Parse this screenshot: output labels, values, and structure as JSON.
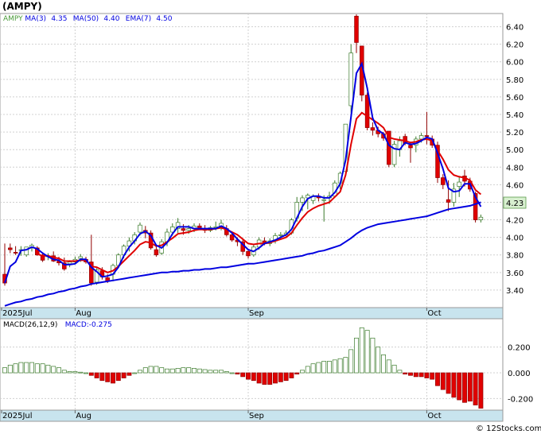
{
  "title": "(AMPY)",
  "watermark": "© 12Stocks.com",
  "colors": {
    "up": "#4a9a3a",
    "down": "#e00000",
    "ma": "#0000e0",
    "ema": "#e00000",
    "axisband": "#c8e4ee",
    "price_box": "#d8f0d0"
  },
  "chart_data": [
    {
      "type": "candlestick",
      "legend": [
        {
          "text": "AMPY",
          "color": "#4a9a3a"
        },
        {
          "text": "MA(3)",
          "color": "#0000e0"
        },
        {
          "text": "4.35",
          "color": "#0000e0"
        },
        {
          "text": "MA(50)",
          "color": "#0000e0"
        },
        {
          "text": "4.40",
          "color": "#0000e0"
        },
        {
          "text": "EMA(7)",
          "color": "#0000e0"
        },
        {
          "text": "4.50",
          "color": "#0000e0"
        }
      ],
      "last_price": "4.23",
      "y_ticks": [
        "3.40",
        "3.60",
        "3.80",
        "4.00",
        "4.20",
        "4.40",
        "4.60",
        "4.80",
        "5.00",
        "5.20",
        "5.40",
        "5.60",
        "5.80",
        "6.00",
        "6.20",
        "6.40"
      ],
      "ylim": [
        3.2,
        6.55
      ],
      "x_labels": [
        {
          "text": "2025Jul",
          "idx": 0
        },
        {
          "text": "Aug",
          "idx": 13
        },
        {
          "text": "Sep",
          "idx": 45
        },
        {
          "text": "Oct",
          "idx": 78
        }
      ],
      "candles": [
        [
          3.58,
          3.93,
          3.45,
          3.48
        ],
        [
          3.88,
          3.93,
          3.82,
          3.86
        ],
        [
          3.83,
          3.9,
          3.8,
          3.82
        ],
        [
          3.85,
          3.9,
          3.79,
          3.86
        ],
        [
          3.8,
          3.89,
          3.78,
          3.89
        ],
        [
          3.88,
          3.93,
          3.84,
          3.91
        ],
        [
          3.88,
          3.9,
          3.79,
          3.8
        ],
        [
          3.8,
          3.83,
          3.72,
          3.74
        ],
        [
          3.78,
          3.82,
          3.74,
          3.79
        ],
        [
          3.79,
          3.84,
          3.72,
          3.73
        ],
        [
          3.73,
          3.78,
          3.68,
          3.71
        ],
        [
          3.71,
          3.77,
          3.62,
          3.64
        ],
        [
          3.7,
          3.74,
          3.66,
          3.72
        ],
        [
          3.72,
          3.78,
          3.7,
          3.75
        ],
        [
          3.76,
          3.81,
          3.72,
          3.78
        ],
        [
          3.75,
          3.78,
          3.7,
          3.72
        ],
        [
          3.72,
          4.03,
          3.45,
          3.48
        ],
        [
          3.49,
          3.65,
          3.46,
          3.63
        ],
        [
          3.62,
          3.66,
          3.52,
          3.55
        ],
        [
          3.54,
          3.58,
          3.48,
          3.5
        ],
        [
          3.58,
          3.7,
          3.5,
          3.68
        ],
        [
          3.68,
          3.82,
          3.66,
          3.8
        ],
        [
          3.8,
          3.92,
          3.76,
          3.9
        ],
        [
          3.9,
          4.0,
          3.84,
          3.96
        ],
        [
          3.96,
          4.06,
          3.92,
          4.03
        ],
        [
          4.06,
          4.17,
          4.02,
          4.14
        ],
        [
          4.08,
          4.13,
          3.99,
          4.05
        ],
        [
          4.05,
          4.08,
          3.86,
          3.88
        ],
        [
          3.86,
          3.92,
          3.78,
          3.8
        ],
        [
          3.82,
          3.98,
          3.8,
          3.95
        ],
        [
          3.95,
          4.1,
          3.9,
          4.06
        ],
        [
          4.06,
          4.16,
          4.02,
          4.12
        ],
        [
          4.1,
          4.22,
          4.05,
          4.17
        ],
        [
          4.1,
          4.15,
          4.03,
          4.08
        ],
        [
          4.08,
          4.14,
          4.04,
          4.1
        ],
        [
          4.1,
          4.16,
          4.06,
          4.13
        ],
        [
          4.13,
          4.16,
          4.09,
          4.1
        ],
        [
          4.1,
          4.14,
          4.05,
          4.08
        ],
        [
          4.08,
          4.13,
          4.06,
          4.11
        ],
        [
          4.11,
          4.18,
          4.08,
          4.12
        ],
        [
          4.12,
          4.2,
          4.08,
          4.16
        ],
        [
          4.1,
          4.14,
          4.01,
          4.03
        ],
        [
          4.03,
          4.06,
          3.95,
          3.97
        ],
        [
          3.97,
          4.0,
          3.9,
          3.95
        ],
        [
          3.95,
          3.99,
          3.8,
          3.84
        ],
        [
          3.84,
          3.86,
          3.76,
          3.79
        ],
        [
          3.8,
          3.92,
          3.78,
          3.89
        ],
        [
          3.89,
          4.0,
          3.86,
          3.97
        ],
        [
          3.96,
          4.0,
          3.91,
          3.93
        ],
        [
          3.93,
          3.99,
          3.9,
          3.96
        ],
        [
          3.96,
          4.05,
          3.93,
          4.02
        ],
        [
          4.02,
          4.06,
          3.98,
          4.03
        ],
        [
          4.03,
          4.08,
          4.01,
          4.05
        ],
        [
          4.05,
          4.22,
          4.03,
          4.2
        ],
        [
          4.22,
          4.46,
          4.18,
          4.4
        ],
        [
          4.4,
          4.48,
          4.3,
          4.45
        ],
        [
          4.45,
          4.5,
          4.32,
          4.48
        ],
        [
          4.42,
          4.49,
          4.38,
          4.47
        ],
        [
          4.47,
          4.5,
          4.41,
          4.45
        ],
        [
          4.42,
          4.48,
          4.18,
          4.43
        ],
        [
          4.45,
          4.52,
          4.38,
          4.47
        ],
        [
          4.47,
          4.65,
          4.45,
          4.62
        ],
        [
          4.62,
          4.75,
          4.55,
          4.73
        ],
        [
          4.75,
          5.29,
          4.7,
          5.29
        ],
        [
          5.5,
          6.2,
          5.42,
          6.1
        ],
        [
          6.52,
          6.54,
          6.1,
          6.22
        ],
        [
          6.18,
          6.18,
          5.55,
          5.62
        ],
        [
          5.62,
          5.65,
          5.22,
          5.25
        ],
        [
          5.25,
          5.31,
          5.16,
          5.22
        ],
        [
          5.22,
          5.26,
          5.14,
          5.18
        ],
        [
          5.18,
          5.2,
          5.1,
          5.13
        ],
        [
          5.21,
          5.21,
          4.8,
          4.83
        ],
        [
          4.83,
          5.1,
          4.8,
          5.06
        ],
        [
          5.0,
          5.15,
          4.92,
          5.1
        ],
        [
          5.15,
          5.18,
          5.05,
          5.07
        ],
        [
          5.05,
          5.09,
          4.85,
          5.02
        ],
        [
          5.05,
          5.15,
          4.97,
          5.12
        ],
        [
          5.12,
          5.19,
          5.08,
          5.16
        ],
        [
          5.16,
          5.43,
          5.06,
          5.15
        ],
        [
          5.12,
          5.16,
          5.02,
          5.05
        ],
        [
          5.05,
          5.09,
          4.62,
          4.68
        ],
        [
          4.68,
          4.72,
          4.55,
          4.6
        ],
        [
          4.43,
          4.65,
          4.3,
          4.4
        ],
        [
          4.4,
          4.62,
          4.35,
          4.55
        ],
        [
          4.58,
          4.7,
          4.46,
          4.63
        ],
        [
          4.7,
          4.77,
          4.58,
          4.64
        ],
        [
          4.64,
          4.68,
          4.52,
          4.55
        ],
        [
          4.5,
          4.52,
          4.17,
          4.2
        ],
        [
          4.2,
          4.26,
          4.17,
          4.23
        ]
      ],
      "ma3": [
        3.48,
        3.67,
        3.72,
        3.85,
        3.86,
        3.89,
        3.87,
        3.82,
        3.78,
        3.75,
        3.74,
        3.69,
        3.69,
        3.7,
        3.75,
        3.75,
        3.66,
        3.61,
        3.55,
        3.56,
        3.58,
        3.66,
        3.79,
        3.89,
        3.96,
        4.04,
        4.07,
        4.02,
        3.91,
        3.88,
        3.94,
        4.04,
        4.12,
        4.12,
        4.12,
        4.1,
        4.1,
        4.1,
        4.1,
        4.1,
        4.13,
        4.1,
        4.05,
        3.98,
        3.92,
        3.86,
        3.84,
        3.88,
        3.93,
        3.95,
        3.97,
        4.0,
        4.03,
        4.09,
        4.22,
        4.35,
        4.44,
        4.47,
        4.47,
        4.45,
        4.45,
        4.51,
        4.61,
        4.88,
        5.37,
        5.87,
        5.98,
        5.7,
        5.36,
        5.22,
        5.18,
        5.05,
        5.01,
        5.0,
        5.08,
        5.06,
        5.07,
        5.1,
        5.14,
        5.12,
        4.96,
        4.78,
        4.56,
        4.52,
        4.53,
        4.61,
        4.61,
        4.46,
        4.35
      ],
      "ema7": [
        null,
        null,
        null,
        null,
        null,
        null,
        3.81,
        3.79,
        3.79,
        3.77,
        3.76,
        3.73,
        3.73,
        3.73,
        3.74,
        3.74,
        3.67,
        3.66,
        3.63,
        3.6,
        3.62,
        3.67,
        3.73,
        3.79,
        3.85,
        3.92,
        3.95,
        3.94,
        3.9,
        3.91,
        3.95,
        3.99,
        4.04,
        4.05,
        4.06,
        4.08,
        4.09,
        4.09,
        4.09,
        4.1,
        4.11,
        4.09,
        4.06,
        4.03,
        3.98,
        3.93,
        3.92,
        3.93,
        3.93,
        3.94,
        3.96,
        3.98,
        4.0,
        4.05,
        4.14,
        4.22,
        4.29,
        4.33,
        4.36,
        4.38,
        4.4,
        4.46,
        4.52,
        4.71,
        5.06,
        5.35,
        5.42,
        5.38,
        5.34,
        5.3,
        5.25,
        5.14,
        5.12,
        5.11,
        5.1,
        5.08,
        5.09,
        5.11,
        5.12,
        5.1,
        4.99,
        4.89,
        4.77,
        4.71,
        4.69,
        4.68,
        4.65,
        4.54,
        4.49
      ],
      "ma50": [
        3.22,
        3.24,
        3.26,
        3.27,
        3.29,
        3.3,
        3.32,
        3.33,
        3.35,
        3.36,
        3.38,
        3.39,
        3.41,
        3.42,
        3.44,
        3.45,
        3.47,
        3.48,
        3.49,
        3.5,
        3.51,
        3.52,
        3.53,
        3.54,
        3.55,
        3.56,
        3.57,
        3.58,
        3.59,
        3.6,
        3.6,
        3.61,
        3.61,
        3.62,
        3.62,
        3.63,
        3.63,
        3.64,
        3.64,
        3.65,
        3.66,
        3.66,
        3.67,
        3.68,
        3.69,
        3.7,
        3.7,
        3.71,
        3.72,
        3.73,
        3.74,
        3.75,
        3.76,
        3.77,
        3.78,
        3.79,
        3.81,
        3.82,
        3.84,
        3.85,
        3.87,
        3.89,
        3.91,
        3.95,
        3.99,
        4.04,
        4.08,
        4.11,
        4.13,
        4.15,
        4.16,
        4.17,
        4.18,
        4.19,
        4.2,
        4.21,
        4.22,
        4.23,
        4.24,
        4.26,
        4.28,
        4.3,
        4.32,
        4.33,
        4.34,
        4.35,
        4.36,
        4.38,
        4.4
      ]
    },
    {
      "type": "histogram",
      "legend": [
        {
          "text": "MACD(26,12,9)",
          "color": "#000000"
        },
        {
          "text": "MACD:-0.275",
          "color": "#0000e0"
        }
      ],
      "y_ticks": [
        "-0.200",
        "0.000",
        "0.200"
      ],
      "ylim": [
        -0.29,
        0.42
      ],
      "x_labels": [
        {
          "text": "2025Jul",
          "idx": 0
        },
        {
          "text": "Aug",
          "idx": 13
        },
        {
          "text": "Sep",
          "idx": 45
        },
        {
          "text": "Oct",
          "idx": 78
        }
      ],
      "values": [
        0.04,
        0.06,
        0.07,
        0.08,
        0.08,
        0.08,
        0.07,
        0.07,
        0.06,
        0.05,
        0.04,
        0.02,
        0.01,
        0.01,
        0.005,
        0.0,
        -0.02,
        -0.04,
        -0.06,
        -0.07,
        -0.08,
        -0.06,
        -0.04,
        -0.02,
        0.0,
        0.02,
        0.04,
        0.05,
        0.05,
        0.04,
        0.03,
        0.03,
        0.035,
        0.04,
        0.04,
        0.035,
        0.03,
        0.025,
        0.02,
        0.02,
        0.02,
        0.01,
        0.0,
        -0.01,
        -0.03,
        -0.05,
        -0.06,
        -0.08,
        -0.09,
        -0.09,
        -0.08,
        -0.07,
        -0.06,
        -0.04,
        -0.01,
        0.02,
        0.05,
        0.07,
        0.08,
        0.09,
        0.09,
        0.1,
        0.11,
        0.12,
        0.18,
        0.27,
        0.35,
        0.33,
        0.27,
        0.2,
        0.14,
        0.1,
        0.06,
        0.02,
        -0.01,
        -0.02,
        -0.03,
        -0.03,
        -0.04,
        -0.05,
        -0.1,
        -0.13,
        -0.16,
        -0.19,
        -0.21,
        -0.23,
        -0.22,
        -0.25,
        -0.275
      ]
    }
  ]
}
